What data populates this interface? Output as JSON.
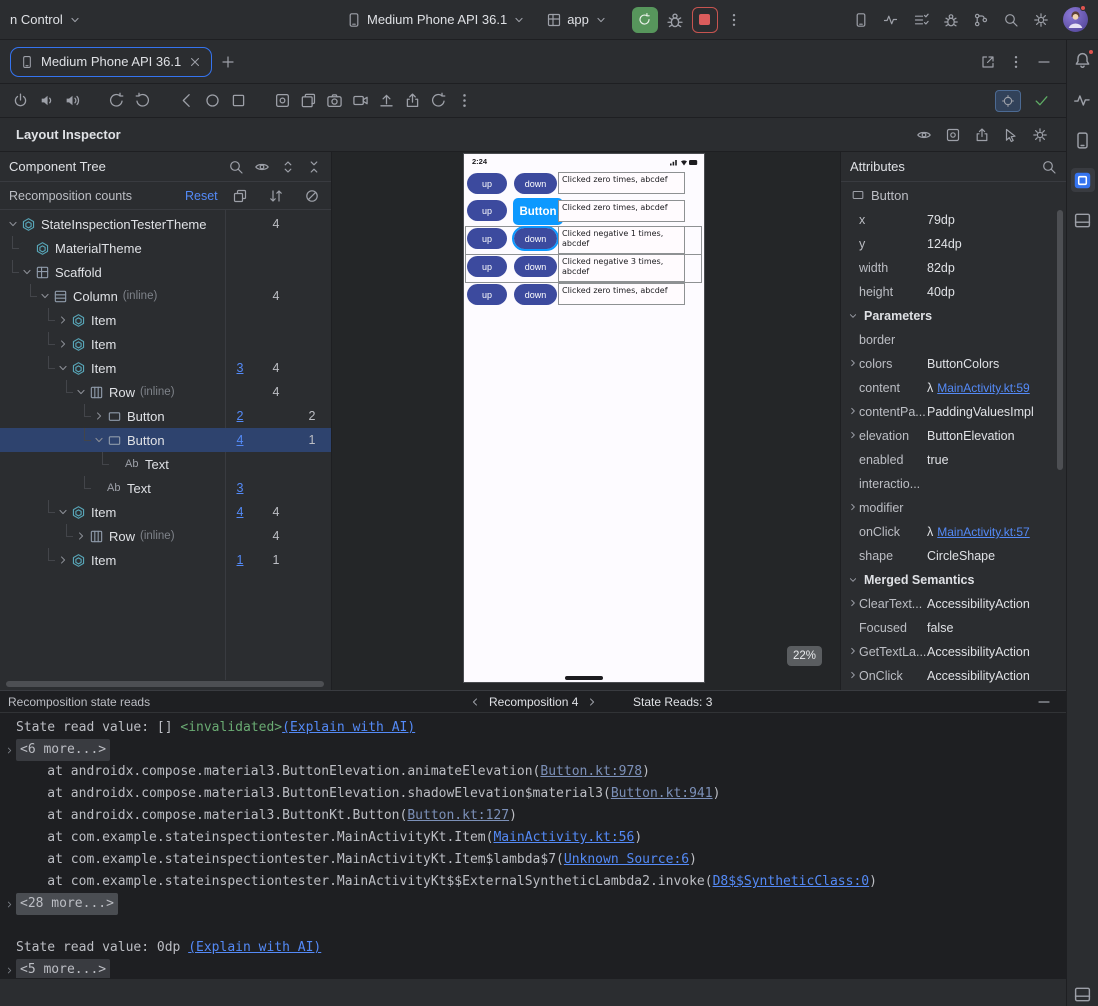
{
  "colors": {
    "accent": "#3574f0",
    "link": "#548af7",
    "selection": "#2e436e",
    "run_green": "#57965c",
    "stop_red": "#db5c5c",
    "device_button": "#3c4a9e",
    "device_button_highlight": "#0d99ff"
  },
  "topbar": {
    "vcs_label": "n Control",
    "device_label": "Medium Phone API 36.1",
    "run_config_label": "app",
    "right_icons": [
      {
        "name": "device-streaming",
        "glyph": "device"
      },
      {
        "name": "profiler",
        "glyph": "pulse"
      },
      {
        "name": "todo-list",
        "glyph": "listChecks"
      },
      {
        "name": "app-insights",
        "glyph": "bug"
      },
      {
        "name": "gradle",
        "glyph": "branch"
      },
      {
        "name": "search-everywhere",
        "glyph": "search"
      },
      {
        "name": "settings",
        "glyph": "gear"
      }
    ]
  },
  "tabbar": {
    "tab_label": "Medium Phone API 36.1",
    "right_icons": [
      {
        "name": "open-in-window",
        "glyph": "external"
      },
      {
        "name": "more-options",
        "glyph": "kebab"
      },
      {
        "name": "hide-toolwindow",
        "glyph": "minus"
      }
    ]
  },
  "emu_toolbar": {
    "left_icons": [
      {
        "name": "power",
        "glyph": "power"
      },
      {
        "name": "volume-down",
        "glyph": "volDown"
      },
      {
        "name": "volume-up",
        "glyph": "volUp"
      },
      {
        "name": "gap"
      },
      {
        "name": "rotate-left",
        "glyph": "rotateL"
      },
      {
        "name": "rotate-right",
        "glyph": "rotateR"
      },
      {
        "name": "gap"
      },
      {
        "name": "back",
        "glyph": "back"
      },
      {
        "name": "home",
        "glyph": "home"
      },
      {
        "name": "overview",
        "glyph": "overview"
      },
      {
        "name": "gap"
      },
      {
        "name": "screenshot",
        "glyph": "screenshot"
      },
      {
        "name": "snapshot-compare",
        "glyph": "layers"
      },
      {
        "name": "camera",
        "glyph": "camera"
      },
      {
        "name": "record-video",
        "glyph": "video"
      },
      {
        "name": "upload",
        "glyph": "upload"
      },
      {
        "name": "share",
        "glyph": "share"
      },
      {
        "name": "reset",
        "glyph": "restore"
      },
      {
        "name": "more",
        "glyph": "kebab"
      }
    ]
  },
  "inspector": {
    "title": "Layout Inspector",
    "icons": [
      {
        "name": "view-options",
        "glyph": "eye"
      },
      {
        "name": "snapshot",
        "glyph": "screenshot"
      },
      {
        "name": "export-snapshot",
        "glyph": "share"
      },
      {
        "name": "pick-element",
        "glyph": "pick"
      },
      {
        "name": "inspector-settings",
        "glyph": "gear"
      }
    ]
  },
  "tree": {
    "title": "Component Tree",
    "subhead_label": "Recomposition counts",
    "reset_label": "Reset",
    "head_icons": [
      {
        "name": "search",
        "glyph": "search"
      },
      {
        "name": "visibility",
        "glyph": "eye"
      },
      {
        "name": "expand-all",
        "glyph": "unfold"
      },
      {
        "name": "collapse-all",
        "glyph": "fold"
      }
    ],
    "column_icons": [
      {
        "name": "recomposition-counts",
        "glyph": "stack"
      },
      {
        "name": "sort-counts",
        "glyph": "sortArrows"
      },
      {
        "name": "disable-counts",
        "glyph": "blocked"
      }
    ],
    "nodes": [
      {
        "label": "StateInspectionTesterTheme",
        "depth": 0,
        "chevron": "down",
        "icon": "compose",
        "c1": "",
        "c2": "4",
        "c3": ""
      },
      {
        "label": "MaterialTheme",
        "depth": 1,
        "chevron": "",
        "icon": "compose",
        "c1": "",
        "c2": "",
        "c3": ""
      },
      {
        "label": "Scaffold",
        "depth": 1,
        "chevron": "down",
        "icon": "grid",
        "c1": "",
        "c2": "",
        "c3": ""
      },
      {
        "label": "Column",
        "suffix": "(inline)",
        "depth": 2,
        "chevron": "down",
        "icon": "column",
        "c1": "",
        "c2": "4",
        "c3": ""
      },
      {
        "label": "Item",
        "depth": 3,
        "chevron": "right",
        "icon": "compose",
        "c1": "",
        "c2": "",
        "c3": ""
      },
      {
        "label": "Item",
        "depth": 3,
        "chevron": "right",
        "icon": "compose",
        "c1": "",
        "c2": "",
        "c3": ""
      },
      {
        "label": "Item",
        "depth": 3,
        "chevron": "down",
        "icon": "compose",
        "c1": "3",
        "c2": "4",
        "c3": ""
      },
      {
        "label": "Row",
        "suffix": "(inline)",
        "depth": 4,
        "chevron": "down",
        "icon": "row",
        "c1": "",
        "c2": "4",
        "c3": ""
      },
      {
        "label": "Button",
        "depth": 5,
        "chevron": "right",
        "icon": "button",
        "c1": "2",
        "c2": "",
        "c3": "2"
      },
      {
        "label": "Button",
        "depth": 5,
        "chevron": "down",
        "icon": "button",
        "c1": "4",
        "c2": "",
        "c3": "1",
        "selected": true
      },
      {
        "label": "Text",
        "depth": 6,
        "chevron": "",
        "icon": "text",
        "c1": "",
        "c2": "",
        "c3": ""
      },
      {
        "label": "Text",
        "depth": 5,
        "chevron": "",
        "icon": "text",
        "c1": "3",
        "c2": "",
        "c3": ""
      },
      {
        "label": "Item",
        "depth": 3,
        "chevron": "down",
        "icon": "compose",
        "c1": "4",
        "c2": "4",
        "c3": ""
      },
      {
        "label": "Row",
        "suffix": "(inline)",
        "depth": 4,
        "chevron": "right",
        "icon": "row",
        "c1": "",
        "c2": "4",
        "c3": ""
      },
      {
        "label": "Item",
        "depth": 3,
        "chevron": "right",
        "icon": "compose",
        "c1": "1",
        "c2": "1",
        "c3": ""
      }
    ]
  },
  "preview": {
    "time": "2:24",
    "zoom": "22%",
    "status_icons": [
      "signal",
      "wifi",
      "battery"
    ],
    "rows": [
      {
        "up": "up",
        "down": "down",
        "lines": [
          "Clicked zero times, abcdef"
        ]
      },
      {
        "up": "up",
        "down": "Button",
        "lines": [
          "Clicked zero times, abcdef"
        ],
        "big": true
      },
      {
        "up": "up",
        "down": "down",
        "lines": [
          "Clicked negative 1 times,",
          "abcdef"
        ],
        "selected": true
      },
      {
        "up": "up",
        "down": "down",
        "lines": [
          "Clicked negative 3 times,",
          "abcdef"
        ]
      },
      {
        "up": "up",
        "down": "down",
        "lines": [
          "Clicked zero times, abcdef"
        ]
      }
    ]
  },
  "attrs": {
    "title": "Attributes",
    "component": "Button",
    "rows": [
      {
        "key": "x",
        "value": "79dp"
      },
      {
        "key": "y",
        "value": "124dp"
      },
      {
        "key": "width",
        "value": "82dp"
      },
      {
        "key": "height",
        "value": "40dp"
      },
      {
        "section": "Parameters"
      },
      {
        "key": "border",
        "value": ""
      },
      {
        "key": "colors",
        "value": "ButtonColors",
        "exp": true
      },
      {
        "key": "content",
        "value": "MainActivity.kt:59",
        "lambda": true
      },
      {
        "key": "contentPa...",
        "value": "PaddingValuesImpl",
        "exp": true
      },
      {
        "key": "elevation",
        "value": "ButtonElevation",
        "exp": true
      },
      {
        "key": "enabled",
        "value": "true"
      },
      {
        "key": "interactio...",
        "value": ""
      },
      {
        "key": "modifier",
        "value": "",
        "exp": true
      },
      {
        "key": "onClick",
        "value": "MainActivity.kt:57",
        "lambda": true
      },
      {
        "key": "shape",
        "value": "CircleShape"
      },
      {
        "section": "Merged Semantics"
      },
      {
        "key": "ClearText...",
        "value": "AccessibilityAction",
        "exp": true
      },
      {
        "key": "Focused",
        "value": "false"
      },
      {
        "key": "GetTextLa...",
        "value": "AccessibilityAction",
        "exp": true
      },
      {
        "key": "OnClick",
        "value": "AccessibilityAction",
        "exp": true
      }
    ]
  },
  "console": {
    "title": "Recomposition state reads",
    "nav_label": "Recomposition 4",
    "reads_label": "State Reads: 3",
    "lines": [
      {
        "type": "state",
        "text": "State read value: [] ",
        "tag": "<invalidated>",
        "link": "(Explain with AI)"
      },
      {
        "type": "fold",
        "text": "<6 more...>"
      },
      {
        "type": "frame",
        "pre": "    at androidx.compose.material3.ButtonElevation.animateElevation(",
        "link": "Button.kt:978",
        "post": ")",
        "dim": true
      },
      {
        "type": "frame",
        "pre": "    at androidx.compose.material3.ButtonElevation.shadowElevation$material3(",
        "link": "Button.kt:941",
        "post": ")",
        "dim": true
      },
      {
        "type": "frame",
        "pre": "    at androidx.compose.material3.ButtonKt.Button(",
        "link": "Button.kt:127",
        "post": ")",
        "dim": true
      },
      {
        "type": "frame",
        "pre": "    at com.example.stateinspectiontester.MainActivityKt.Item(",
        "link": "MainActivity.kt:56",
        "post": ")"
      },
      {
        "type": "frame",
        "pre": "    at com.example.stateinspectiontester.MainActivityKt.Item$lambda$7(",
        "link": "Unknown Source:6",
        "post": ")"
      },
      {
        "type": "frame",
        "pre": "    at com.example.stateinspectiontester.MainActivityKt$$ExternalSyntheticLambda2.invoke(",
        "link": "D8$$SyntheticClass:0",
        "post": ")"
      },
      {
        "type": "fold",
        "text": "<28 more...>",
        "selected": true
      },
      {
        "type": "blank"
      },
      {
        "type": "state",
        "text": "State read value: 0dp ",
        "tag": "",
        "link": "(Explain with AI)"
      },
      {
        "type": "fold",
        "text": "<5 more...>"
      }
    ]
  },
  "stripe": {
    "items": [
      {
        "name": "notifications",
        "glyph": "bell",
        "dot": true
      },
      {
        "name": "profiler",
        "glyph": "pulse"
      },
      {
        "name": "device-manager",
        "glyph": "device"
      },
      {
        "name": "layout-inspector",
        "glyph": "liActive",
        "active": true
      },
      {
        "name": "logcat",
        "glyph": "panelBottom"
      }
    ],
    "tray": {
      "name": "tool-window-layout",
      "glyph": "panelBottom"
    }
  }
}
